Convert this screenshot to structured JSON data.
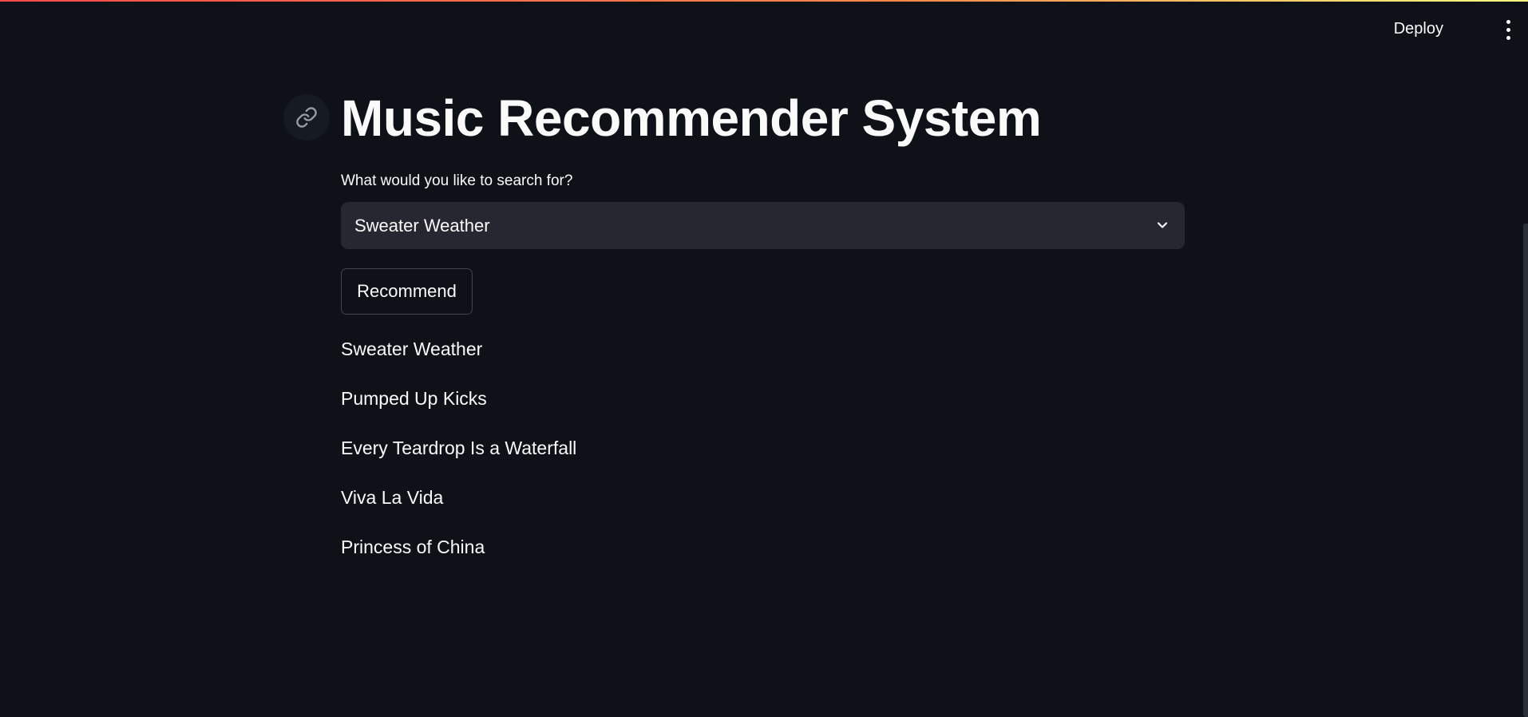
{
  "header": {
    "deploy_label": "Deploy",
    "menu_icon": "vertical-dots-icon"
  },
  "title": {
    "text": "Music Recommender System",
    "anchor_icon": "link-icon"
  },
  "search": {
    "label": "What would you like to search for?",
    "selected_value": "Sweater Weather",
    "dropdown_icon": "chevron-down-icon"
  },
  "actions": {
    "recommend_label": "Recommend"
  },
  "results": [
    "Sweater Weather",
    "Pumped Up Kicks",
    "Every Teardrop Is a Waterfall",
    "Viva La Vida",
    "Princess of China"
  ],
  "colors": {
    "background": "#0e1117",
    "text": "#fafafa",
    "select_background": "#262730",
    "button_border": "#41444c",
    "accent": "#ff4b4b"
  }
}
